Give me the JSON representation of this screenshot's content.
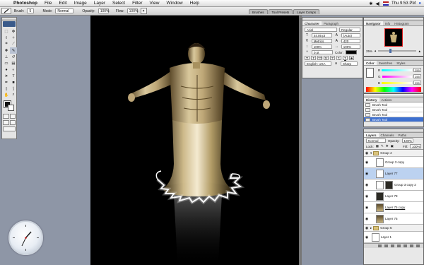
{
  "menubar": {
    "app": "Photoshop",
    "items": [
      "File",
      "Edit",
      "Image",
      "Layer",
      "Select",
      "Filter",
      "View",
      "Window",
      "Help"
    ],
    "clock_text": "Thu 9:53 PM"
  },
  "options": {
    "brush_label": "Brush:",
    "brush_size": "5",
    "mode_label": "Mode:",
    "mode_value": "Normal",
    "opacity_label": "Opacity:",
    "opacity_value": "100%",
    "flow_label": "Flow:",
    "flow_value": "100%"
  },
  "palette_well": {
    "tabs": [
      "Brushes",
      "Tool Presets",
      "Layer Comps"
    ]
  },
  "character_panel": {
    "tabs": [
      "Character",
      "Paragraph"
    ],
    "font_family": "Arial",
    "font_style": "Regular",
    "font_size": "44.05 pt",
    "leading": "(Auto)",
    "kerning": "Metrics",
    "tracking": "420",
    "vertical_scale": "100%",
    "horizontal_scale": "100%",
    "baseline": "0 pt",
    "color_label": "Color:",
    "style_buttons": [
      "T",
      "T",
      "TT",
      "Tr",
      "T'",
      "T,",
      "T",
      "T"
    ],
    "language": "English: USA",
    "antialias": "Sharp"
  },
  "navigator": {
    "tabs": [
      "Navigator",
      "Info",
      "Histogram"
    ],
    "zoom": "25%"
  },
  "color_panel": {
    "tabs": [
      "Color",
      "Swatches",
      "Styles"
    ],
    "channels": [
      {
        "label": "R",
        "value": "255"
      },
      {
        "label": "G",
        "value": "255"
      },
      {
        "label": "B",
        "value": "255"
      }
    ]
  },
  "history": {
    "tabs": [
      "History",
      "Actions"
    ],
    "items": [
      "Brush Tool",
      "Brush Tool",
      "Brush Tool",
      "Brush Tool"
    ]
  },
  "layers": {
    "tabs": [
      "Layers",
      "Channels",
      "Paths"
    ],
    "blend_mode": "Normal",
    "opacity_label": "Opacity:",
    "opacity_value": "100%",
    "lock_label": "Lock:",
    "fill_label": "Fill:",
    "fill_value": "100%",
    "rows": [
      {
        "name": "Group 4",
        "kind": "group"
      },
      {
        "name": "Group 3 copy",
        "kind": "layer"
      },
      {
        "name": "Layer 77",
        "kind": "layer"
      },
      {
        "name": "Group 3 copy 2",
        "kind": "layer"
      },
      {
        "name": "Layer 78",
        "kind": "layer"
      },
      {
        "name": "Layer 75 copy",
        "kind": "layer"
      },
      {
        "name": "Layer 75",
        "kind": "layer"
      },
      {
        "name": "Group 5",
        "kind": "group"
      },
      {
        "name": "Layer 1",
        "kind": "layer"
      }
    ]
  },
  "colors": {
    "canvas_bg": "#000000",
    "desktop": "#8e96a6",
    "history_selected": "#3d6fcf",
    "layer_selected": "#bcd2f0",
    "glow": "#ffffff"
  }
}
